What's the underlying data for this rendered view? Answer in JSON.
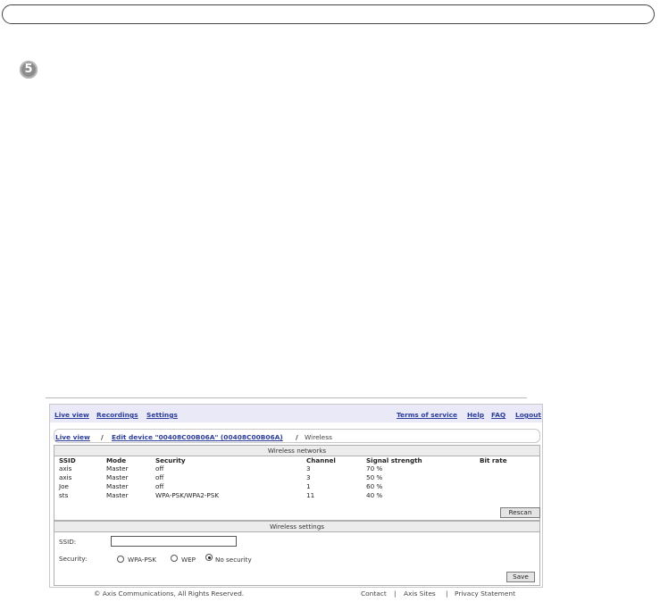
{
  "step": {
    "number": "5"
  },
  "navbar": {
    "left_links": [
      {
        "label": "Live view"
      },
      {
        "label": "Recordings"
      },
      {
        "label": "Settings"
      }
    ],
    "right_links": [
      {
        "label": "Terms of service"
      },
      {
        "label": "Help"
      },
      {
        "label": "FAQ"
      },
      {
        "label": "Logout"
      }
    ]
  },
  "breadcrumb": {
    "items": [
      {
        "label": "Live view"
      },
      {
        "label": "Edit device \"00408C00B06A\" (00408C00B06A)"
      }
    ],
    "separator": "/",
    "current": "Wireless"
  },
  "networks_panel": {
    "title": "Wireless networks",
    "columns": [
      "SSID",
      "Mode",
      "Security",
      "Channel",
      "Signal strength",
      "Bit rate"
    ],
    "rows": [
      {
        "ssid": "axis",
        "mode": "Master",
        "security": "off",
        "channel": "3",
        "signal": "70 %",
        "bitrate": ""
      },
      {
        "ssid": "axis",
        "mode": "Master",
        "security": "off",
        "channel": "3",
        "signal": "50 %",
        "bitrate": ""
      },
      {
        "ssid": "Joe",
        "mode": "Master",
        "security": "off",
        "channel": "1",
        "signal": "60 %",
        "bitrate": ""
      },
      {
        "ssid": "sts",
        "mode": "Master",
        "security": "WPA-PSK/WPA2-PSK",
        "channel": "11",
        "signal": "40 %",
        "bitrate": ""
      }
    ],
    "rescan_label": "Rescan"
  },
  "settings_panel": {
    "title": "Wireless settings",
    "ssid_label": "SSID:",
    "ssid_value": "",
    "security_label": "Security:",
    "security_options": [
      {
        "label": "WPA-PSK",
        "selected": false
      },
      {
        "label": "WEP",
        "selected": false
      },
      {
        "label": "No security",
        "selected": true
      }
    ],
    "save_label": "Save"
  },
  "footer": {
    "copyright": "© Axis Communications, All Rights Reserved.",
    "links": [
      "Contact",
      "Axis Sites",
      "Privacy Statement"
    ],
    "separator": "|"
  },
  "colors": {
    "link": "#2c3d9c",
    "navbar_bg": "#e9e9f7",
    "panel_header_bg": "#ececec",
    "badge": "#8c8c8c"
  }
}
